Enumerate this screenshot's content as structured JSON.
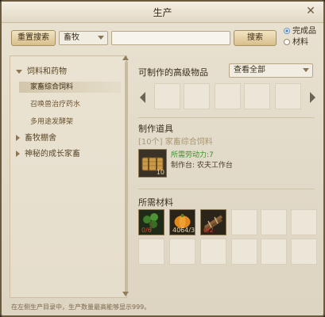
{
  "window": {
    "title": "生产",
    "close_glyph": "✕"
  },
  "toolbar": {
    "reset_label": "重置搜索",
    "category_select": "畜牧",
    "search_value": "",
    "search_label": "搜索",
    "radio_options": [
      {
        "label": "完成品",
        "selected": true
      },
      {
        "label": "材料",
        "selected": false
      }
    ]
  },
  "tree": {
    "groups": [
      {
        "label": "饲料和药物",
        "expanded": true,
        "children": [
          "家畜综合饲料",
          "召唤兽治疗药水",
          "多用途发酵架"
        ]
      },
      {
        "label": "畜牧棚舍",
        "expanded": false,
        "children": []
      },
      {
        "label": "神秘的成长家畜",
        "expanded": false,
        "children": []
      }
    ],
    "selected": "家畜综合饲料"
  },
  "craftable": {
    "label": "可制作的高级物品",
    "filter_select": "查看全部"
  },
  "craft_tool": {
    "section_label": "制作道具",
    "item_name": "[10个] 家畜综合饲料",
    "item_count": "10",
    "labor_text": "所需劳动力:7",
    "station_text": "制作台: 农夫工作台"
  },
  "materials": {
    "section_label": "所需材料",
    "items": [
      {
        "icon": "herb-icon",
        "qty": "0/6",
        "qty_color": "red"
      },
      {
        "icon": "pumpkin-icon",
        "qty": "4064/3",
        "qty_color": "normal"
      },
      {
        "icon": "wood-bundle-icon",
        "qty": "0/2",
        "qty_color": "red"
      }
    ]
  },
  "footer": {
    "note": "在左侧生产目录中，生产数量最高能够显示999。"
  },
  "colors": {
    "accent_gold": "#d8bf8c",
    "labor_green": "#3c8d2a",
    "qty_red": "#d9462c"
  }
}
